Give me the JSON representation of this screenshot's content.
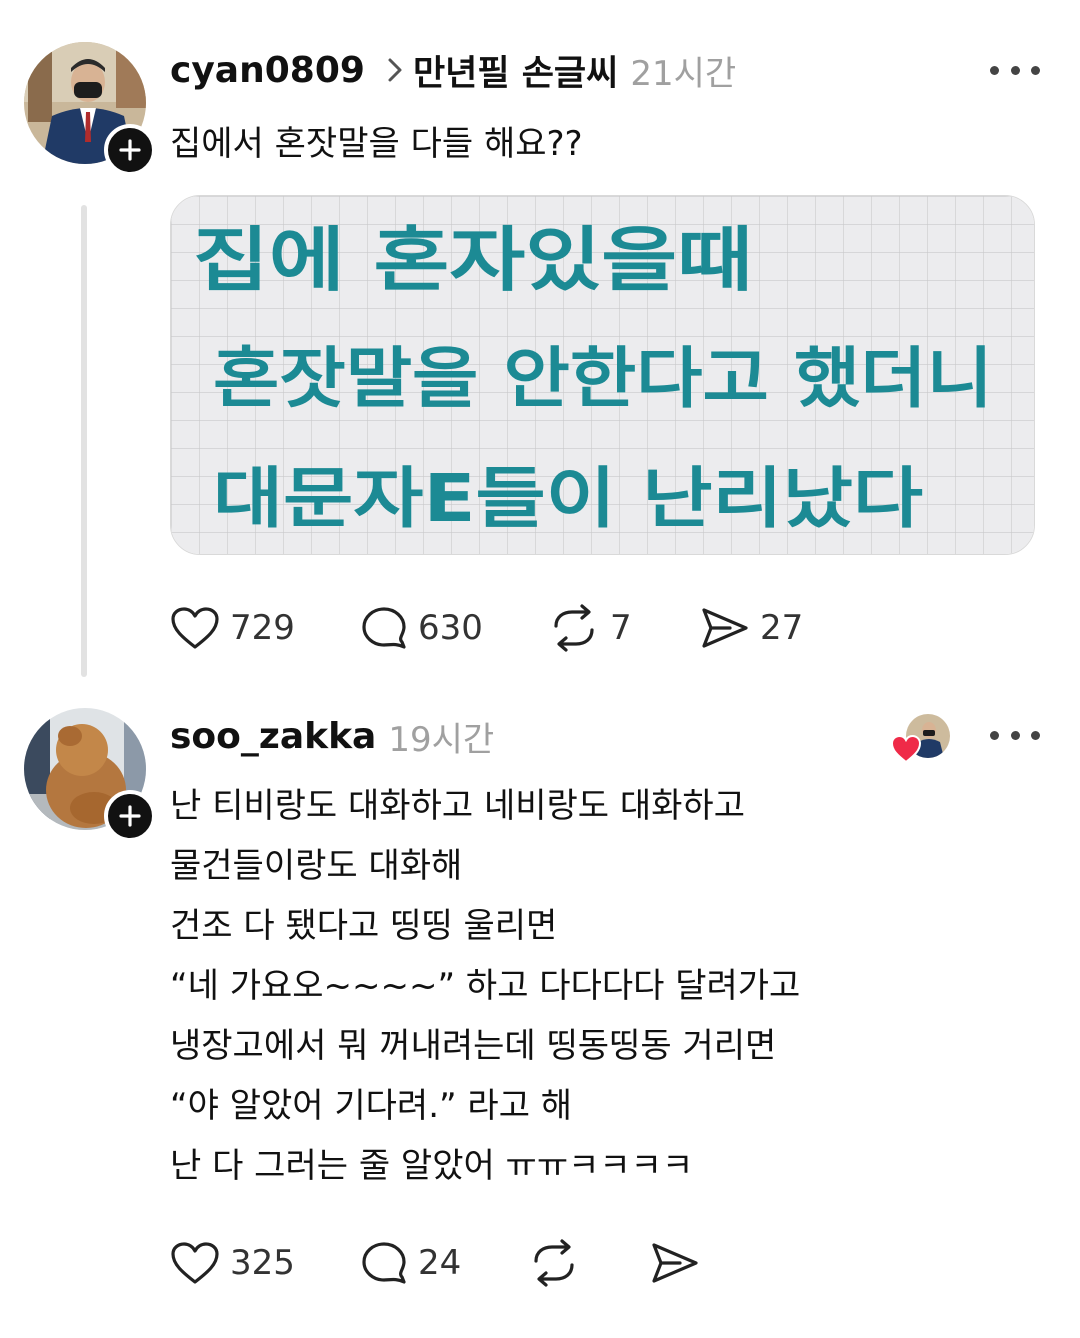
{
  "colors": {
    "background": "#ffffff",
    "text": "#111111",
    "muted": "#a0a0a0",
    "thread_line": "#e2e2e2",
    "ink": "#1c8a94",
    "heart": "#ef2a48"
  },
  "post": {
    "username": "cyan0809",
    "topic": "만년필 손글씨",
    "time": "21시간",
    "text": "집에서 혼잣말을 다들 해요??",
    "image": {
      "lines": [
        "집에 혼자있을때",
        "혼잣말을 안한다고 했더니",
        "대문자E들이 난리났다"
      ]
    },
    "actions": {
      "likes": "729",
      "comments": "630",
      "reposts": "7",
      "shares": "27"
    },
    "icons": [
      "heart-icon",
      "comment-icon",
      "repost-icon",
      "share-icon",
      "more-icon",
      "chevron-right-icon",
      "follow-plus-icon"
    ]
  },
  "reply": {
    "username": "soo_zakka",
    "time": "19시간",
    "lines": [
      "난 티비랑도 대화하고 네비랑도 대화하고",
      "물건들이랑도 대화해",
      "건조 다 됐다고 띵띵 울리면",
      "“네 가요오~~~~” 하고 다다다다 달려가고",
      "냉장고에서 뭐 꺼내려는데 띵동띵동 거리면",
      "“야 알았어 기다려.” 라고 해",
      "난 다 그러는 줄 알았어 ㅠㅠㅋㅋㅋㅋ"
    ],
    "actions": {
      "likes": "325",
      "comments": "24"
    }
  }
}
